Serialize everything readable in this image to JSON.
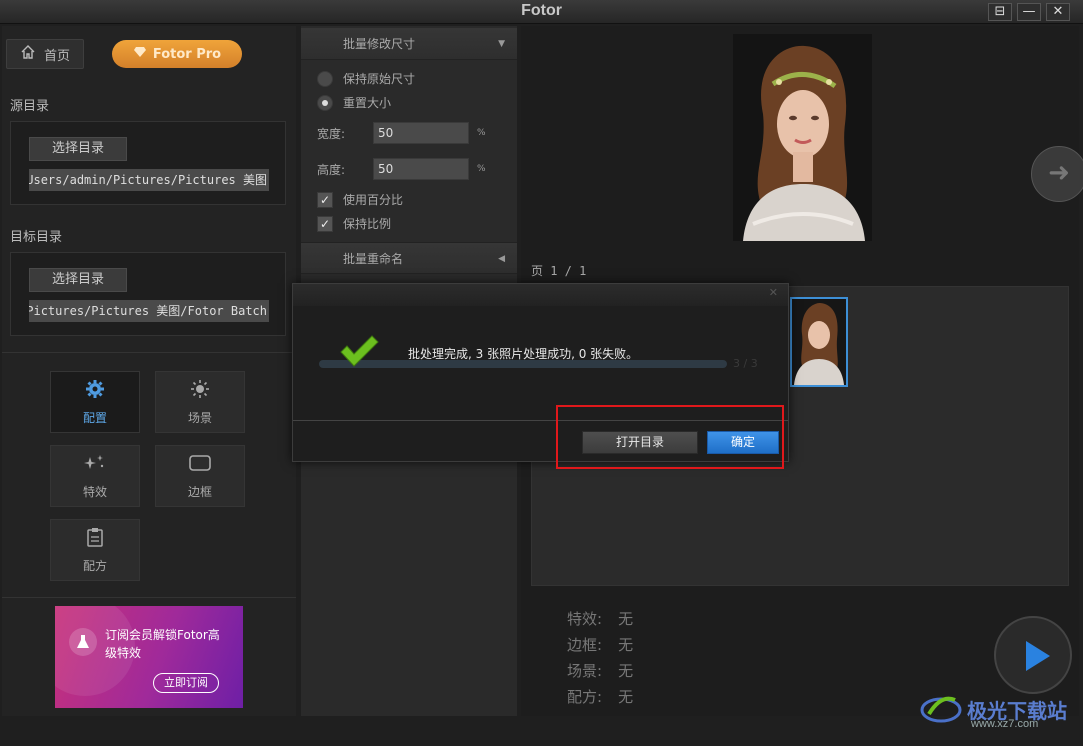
{
  "window": {
    "title": "Fotor",
    "controls": [
      "⊟",
      "—",
      "✕"
    ]
  },
  "left": {
    "home_label": "首页",
    "pro_label": "Fotor Pro",
    "source": {
      "label": "源目录",
      "button": "选择目录",
      "path": "Users/admin/Pictures/Pictures 美图"
    },
    "target": {
      "label": "目标目录",
      "button": "选择目录",
      "path": "Pictures/Pictures 美图/Fotor Batch"
    },
    "tools": [
      {
        "label": "配置",
        "icon": "gear-icon",
        "active": true
      },
      {
        "label": "场景",
        "icon": "sun-icon",
        "active": false
      },
      {
        "label": "特效",
        "icon": "sparkle-icon",
        "active": false
      },
      {
        "label": "边框",
        "icon": "frame-icon",
        "active": false
      },
      {
        "label": "配方",
        "icon": "clipboard-icon",
        "active": false
      }
    ],
    "promo": {
      "text": "订阅会员解锁Fotor高级特效",
      "button": "立即订阅"
    }
  },
  "middle": {
    "resize_header": "批量修改尺寸",
    "keep_original": "保持原始尺寸",
    "resize": "重置大小",
    "width_label": "宽度:",
    "width_value": "50",
    "height_label": "高度:",
    "height_value": "50",
    "unit": "%",
    "use_percent": "使用百分比",
    "keep_ratio": "保持比例",
    "rename_header": "批量重命名"
  },
  "right": {
    "page_info": "页 1 / 1",
    "info": [
      {
        "key": "特效:",
        "value": "无"
      },
      {
        "key": "边框:",
        "value": "无"
      },
      {
        "key": "场景:",
        "value": "无"
      },
      {
        "key": "配方:",
        "value": "无"
      }
    ],
    "watermark": "极光下载站",
    "watermark_url": "www.xz7.com"
  },
  "dialog": {
    "message": "批处理完成, 3 张照片处理成功, 0 张失败。",
    "count": "3 / 3",
    "progress": 1.0,
    "open_button": "打开目录",
    "ok_button": "确定"
  },
  "colors": {
    "accent_blue": "#2a82e0",
    "pro_orange": "#e0922f",
    "highlight_red": "#e0181b",
    "check_green": "#6cbf1f"
  }
}
